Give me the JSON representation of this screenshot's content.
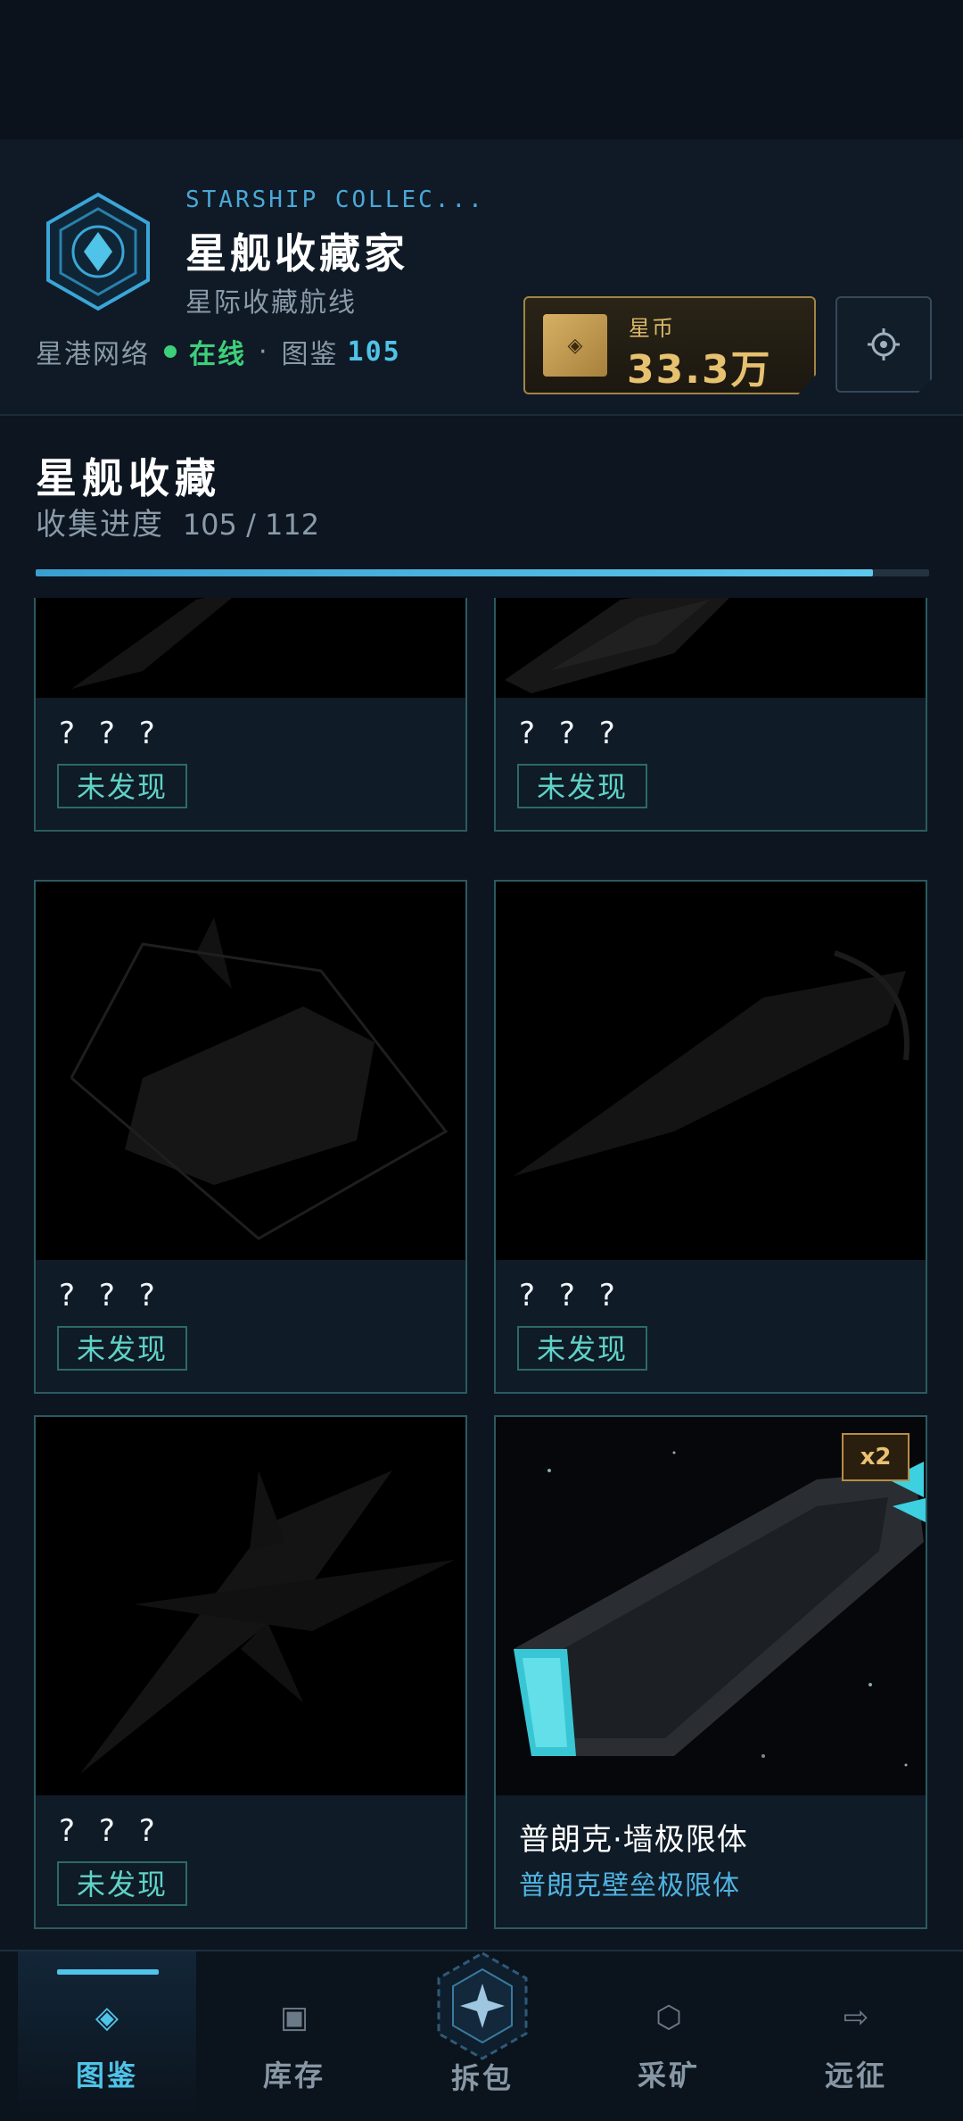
{
  "header": {
    "app_name_en": "STARSHIP COLLEC...",
    "app_title": "星舰收藏家",
    "app_subtitle": "星际收藏航线",
    "network_label": "星港网络",
    "online_status": "在线",
    "separator": "·",
    "codex_label": "图鉴",
    "codex_count": "105",
    "currency": {
      "label": "星币",
      "value": "33.3万"
    }
  },
  "section": {
    "title": "星舰收藏",
    "progress_label": "收集进度",
    "progress_current": 105,
    "progress_total": 112,
    "progress_text": "105 / 112",
    "progress_fraction": 0.9375
  },
  "cards": [
    {
      "title": "? ? ?",
      "status": "未发现",
      "discovered": false
    },
    {
      "title": "? ? ?",
      "status": "未发现",
      "discovered": false
    },
    {
      "title": "? ? ?",
      "status": "未发现",
      "discovered": false
    },
    {
      "title": "? ? ?",
      "status": "未发现",
      "discovered": false
    },
    {
      "title": "? ? ?",
      "status": "未发现",
      "discovered": false
    },
    {
      "title": "普朗克·墙极限体",
      "subtitle": "普朗克壁垒极限体",
      "badge": "x2",
      "discovered": true
    }
  ],
  "nav": {
    "items": [
      {
        "label": "图鉴",
        "icon": "codex-icon",
        "active": true
      },
      {
        "label": "库存",
        "icon": "inventory-icon",
        "active": false
      },
      {
        "label": "拆包",
        "icon": "unpack-icon",
        "active": false
      },
      {
        "label": "采矿",
        "icon": "mining-icon",
        "active": false
      },
      {
        "label": "远征",
        "icon": "expedition-icon",
        "active": false
      }
    ]
  },
  "colors": {
    "accent": "#4fc3e8",
    "online": "#3ecf7a",
    "gold": "#e6c170",
    "card_border": "#2b5a5f",
    "tag_text": "#5fd3c7"
  }
}
